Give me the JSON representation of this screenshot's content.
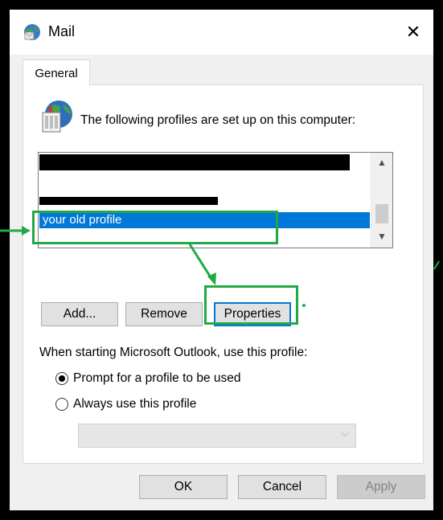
{
  "window": {
    "title": "Mail",
    "close_glyph": "✕",
    "icon": "mail-globe-icon"
  },
  "tabs": [
    {
      "label": "General"
    }
  ],
  "general": {
    "intro_text": "The following profiles are set up on this computer:",
    "profiles": {
      "items": [
        {
          "label": "",
          "redacted": true
        },
        {
          "label": "",
          "redacted": true
        },
        {
          "label": "your old profile",
          "selected": true
        }
      ],
      "scroll_up_glyph": "▲",
      "scroll_down_glyph": "▼"
    },
    "buttons": {
      "add": "Add...",
      "remove": "Remove",
      "properties": "Properties"
    },
    "startup_label": "When starting Microsoft Outlook, use this profile:",
    "radio_prompt": "Prompt for a profile to be used",
    "radio_always": "Always use this profile",
    "selected_option": "prompt",
    "profile_combo_value": ""
  },
  "footer": {
    "ok": "OK",
    "cancel": "Cancel",
    "apply": "Apply"
  },
  "colors": {
    "highlight": "#22a946",
    "selection": "#0078d7"
  }
}
